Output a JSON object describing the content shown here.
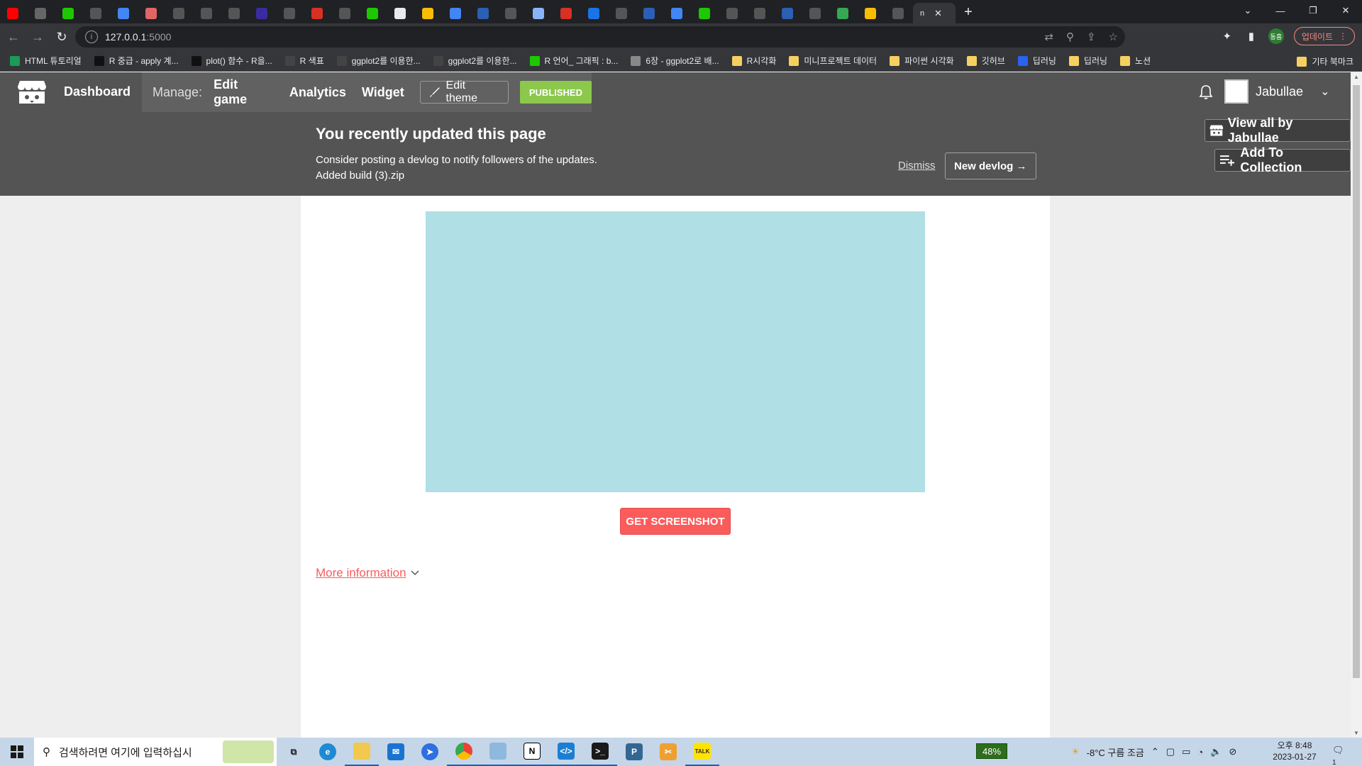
{
  "browser": {
    "tab_count_before_active": 33,
    "active_tab_title": "n",
    "url_host": "127.0.0.1",
    "url_port": ":5000",
    "update_label": "업데이트",
    "profile_initials": "동흠"
  },
  "bookmarks": [
    {
      "label": "HTML 튜토리얼",
      "color": "#1a9b57"
    },
    {
      "label": "R 중급 - apply 계...",
      "color": "#111111"
    },
    {
      "label": "plot() 함수 - R을...",
      "color": "#111111"
    },
    {
      "label": "R 색표",
      "color": "#444444"
    },
    {
      "label": "ggplot2를 이용한...",
      "color": "#444444"
    },
    {
      "label": "ggplot2를 이용한...",
      "color": "#444444"
    },
    {
      "label": "R 언어_ 그래픽 : b...",
      "color": "#1ec800"
    },
    {
      "label": "6장 - ggplot2로 배...",
      "color": "#888888"
    },
    {
      "label": "R시각화",
      "color": "#f5d061"
    },
    {
      "label": "미니프로젝트 데이터",
      "color": "#f5d061"
    },
    {
      "label": "파이썬 시각화",
      "color": "#f5d061"
    },
    {
      "label": "깃허브",
      "color": "#f5d061"
    },
    {
      "label": "딥러닝",
      "color": "#2a62f2"
    },
    {
      "label": "딥러닝",
      "color": "#f5d061"
    },
    {
      "label": "노션",
      "color": "#f5d061"
    }
  ],
  "bookmarks_other": "기타 북마크",
  "header": {
    "dashboard": "Dashboard",
    "manage_label": "Manage:",
    "edit_game": "Edit game",
    "analytics": "Analytics",
    "widget": "Widget",
    "edit_theme": "Edit theme",
    "published": "PUBLISHED",
    "username": "Jabullae"
  },
  "banner": {
    "title": "You recently updated this page",
    "line1": "Consider posting a devlog to notify followers of the updates.",
    "line2": "Added build (3).zip",
    "dismiss": "Dismiss",
    "new_devlog": "New devlog →"
  },
  "side": {
    "view_all": "View all by Jabullae",
    "add_collection": "Add To Collection"
  },
  "content": {
    "get_screenshot": "GET SCREENSHOT",
    "more_info": "More information"
  },
  "taskbar": {
    "search_placeholder": "검색하려면 여기에 입력하십시",
    "battery": "48%",
    "weather": "-8°C  구름 조금",
    "time": "오후 8:48",
    "date": "2023-01-27",
    "notifications": "1"
  },
  "colors": {
    "itch_header": "#545454",
    "published_green": "#8cc84b",
    "accent_red": "#fa5c5c",
    "game_frame": "#b0dfe5"
  }
}
